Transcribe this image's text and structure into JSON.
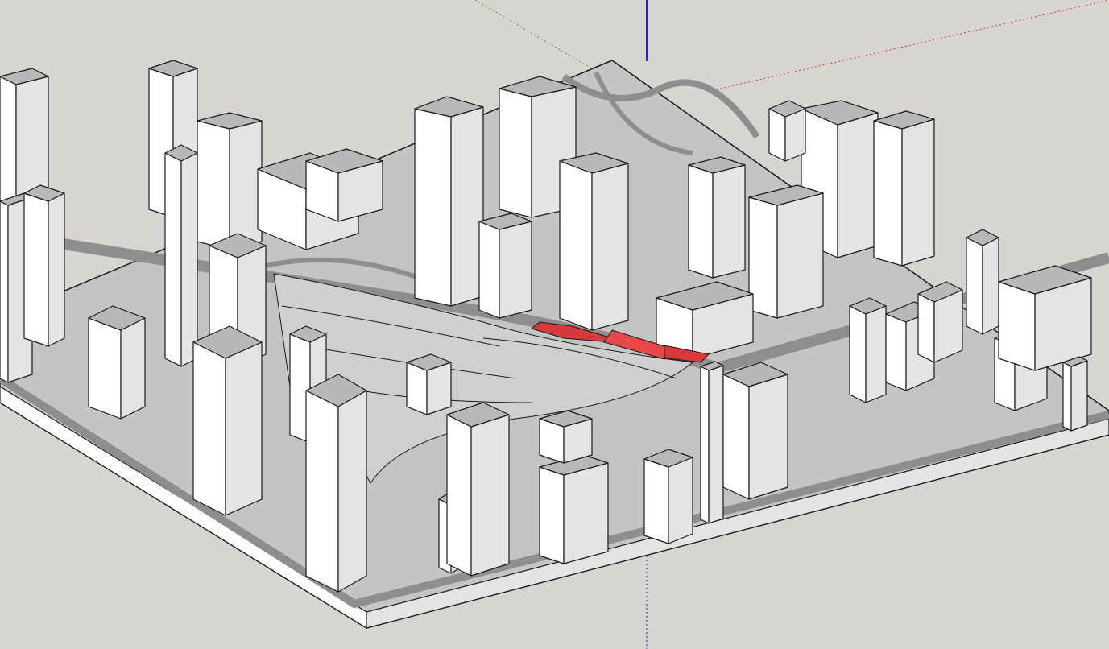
{
  "app": {
    "type": "3d-modeling-viewport",
    "background_color": "#d6d5d0"
  },
  "axes": {
    "red_color": "#cc3333",
    "green_color": "#3a9a3a",
    "blue_color": "#2222cc"
  },
  "model": {
    "description_icon": "city-block-model",
    "building_face_light": "#ffffff",
    "building_face_mid": "#e4e4e4",
    "building_face_dark": "#b8b8b8",
    "ground_color": "#c4c4c4",
    "road_color": "#8e8e8e",
    "edge_color": "#1a1a1a",
    "selected_color": "#d63a3a"
  }
}
